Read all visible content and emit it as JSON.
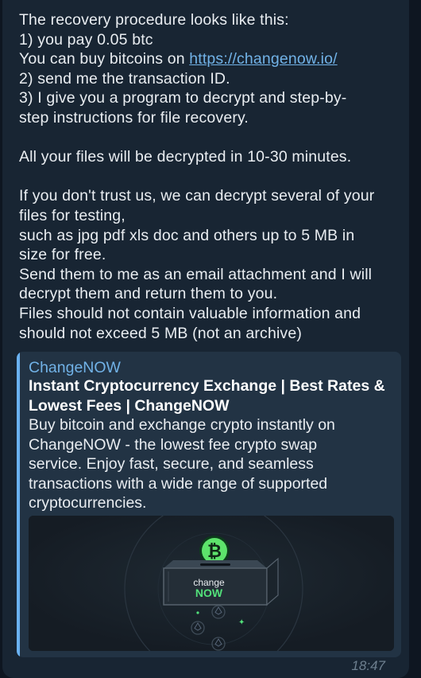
{
  "message": {
    "lines": [
      "The recovery procedure looks like this:",
      "1) you pay 0.05 btc",
      "You can buy bitcoins on ",
      "2) send me the transaction ID.",
      "3) I give you a program to decrypt and step-by-",
      "step instructions for file recovery.",
      "All your files will be decrypted in 10-30 minutes.",
      "If you don't trust us, we can decrypt several of your",
      "files for testing,",
      "such as jpg pdf xls doc and others up to 5 MB in",
      "size for free.",
      "Send them to me as an email attachment and I will",
      "decrypt them and return them to you.",
      "Files should not contain valuable information and",
      "should not exceed 5 MB (not an archive)"
    ],
    "link": "https://changenow.io/"
  },
  "preview": {
    "site_name": "ChangeNOW",
    "title_lines": [
      "Instant Cryptocurrency Exchange | Best Rates &",
      "Lowest Fees | ChangeNOW"
    ],
    "description_lines": [
      "Buy bitcoin and exchange crypto instantly on",
      "ChangeNOW - the lowest fee crypto swap",
      "service. Enjoy fast, secure, and seamless",
      "transactions with a wide range of supported",
      "cryptocurrencies."
    ],
    "image": {
      "coin_symbol": "₿",
      "box_text_top": "change",
      "box_text_bottom": "NOW",
      "coin_color": "#5de36b",
      "brand_green": "#52e07a"
    }
  },
  "timestamp": "18:47",
  "colors": {
    "background": "#0e1621",
    "bubble": "#182533",
    "link": "#71b2e7",
    "accent_bar": "#6ab2f2"
  }
}
